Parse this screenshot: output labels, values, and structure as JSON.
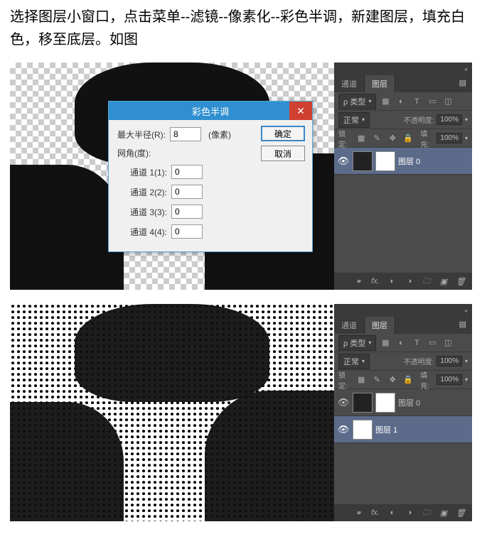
{
  "instruction": "选择图层小窗口，点击菜单--滤镜--像素化--彩色半调，新建图层，填充白色，移至底层。如图",
  "dialog": {
    "title": "彩色半调",
    "close": "✕",
    "max_radius_label": "最大半径(R):",
    "max_radius_value": "8",
    "unit": "(像素)",
    "grid_angle_label": "网角(度):",
    "channel1_label": "通道 1(1):",
    "channel1_value": "0",
    "channel2_label": "通道 2(2):",
    "channel2_value": "0",
    "channel3_label": "通道 3(3):",
    "channel3_value": "0",
    "channel4_label": "通道 4(4):",
    "channel4_value": "0",
    "ok": "确定",
    "cancel": "取消"
  },
  "panel": {
    "tab_channels": "通道",
    "tab_layers": "图层",
    "menu_glyph": "▤",
    "collapse": "«",
    "kind_label": "ρ 类型",
    "blend_mode": "正常",
    "opacity_label": "不透明度:",
    "opacity_value": "100%",
    "lock_label": "锁定:",
    "fill_label": "填充:",
    "fill_value": "100%",
    "layer0": "图层 0",
    "layer1": "图层 1",
    "eye": "👁",
    "icons": {
      "image": "▦",
      "adjust": "◐",
      "text": "T",
      "shape": "▭",
      "smart": "◫",
      "lock_full": "🔒",
      "lock_pixel": "✎",
      "lock_pos": "✥",
      "lock_all": "🔒",
      "link": "⚭",
      "fx": "fx.",
      "mask": "◐",
      "folder": "🗀",
      "adjust2": "◑",
      "new": "▣",
      "trash": "🗑"
    }
  }
}
